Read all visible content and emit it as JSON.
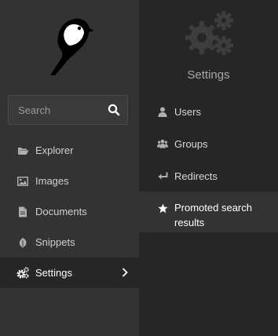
{
  "search": {
    "placeholder": "Search"
  },
  "menu": {
    "items": [
      {
        "label": "Explorer",
        "icon": "folder-open-icon"
      },
      {
        "label": "Images",
        "icon": "image-icon"
      },
      {
        "label": "Documents",
        "icon": "document-icon"
      },
      {
        "label": "Snippets",
        "icon": "snippet-icon"
      },
      {
        "label": "Settings",
        "icon": "cogs-icon",
        "active": true
      }
    ]
  },
  "submenu": {
    "title": "Settings",
    "items": [
      {
        "label": "Users",
        "icon": "user-icon"
      },
      {
        "label": "Groups",
        "icon": "group-icon"
      },
      {
        "label": "Redirects",
        "icon": "redirect-icon"
      },
      {
        "label": "Promoted search results",
        "icon": "star-icon",
        "highlighted": true
      }
    ]
  },
  "colors": {
    "sidebar_bg": "#333333",
    "panel_bg": "#262626",
    "text": "#e6e6e6",
    "muted": "#a8a8a8"
  }
}
